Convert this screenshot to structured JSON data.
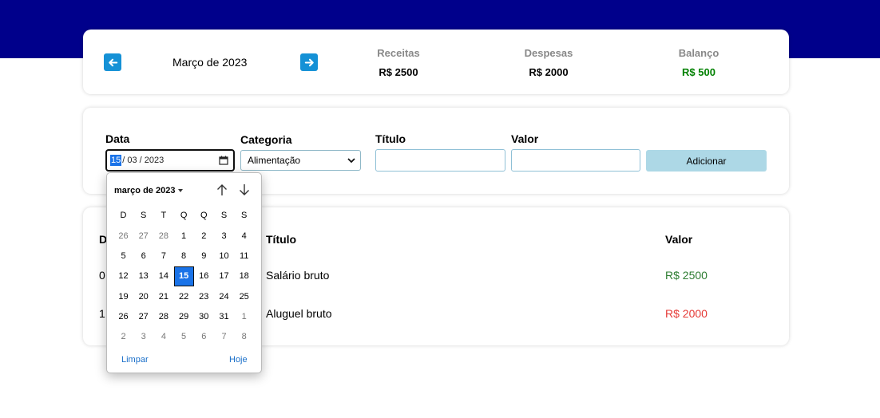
{
  "summary": {
    "month_title": "Março de 2023",
    "receitas": {
      "label": "Receitas",
      "value": "R$ 2500",
      "color": "#000000"
    },
    "despesas": {
      "label": "Despesas",
      "value": "R$ 2000",
      "color": "#000000"
    },
    "balanco": {
      "label": "Balanço",
      "value": "R$ 500",
      "color": "#008000"
    }
  },
  "form": {
    "data_label": "Data",
    "date_day": "15",
    "date_rest": "/ 03 / 2023",
    "categoria_label": "Categoria",
    "categoria_selected": "Alimentação",
    "titulo_label": "Título",
    "valor_label": "Valor",
    "add_label": "Adicionar"
  },
  "table": {
    "headers": {
      "data": "D",
      "titulo": "Título",
      "valor": "Valor"
    },
    "rows": [
      {
        "data": "0",
        "titulo": "Salário bruto",
        "valor": "R$ 2500",
        "valor_color": "#2e7d32"
      },
      {
        "data": "1",
        "titulo": "Aluguel bruto",
        "valor": "R$ 2000",
        "valor_color": "#e53935"
      }
    ]
  },
  "datepicker": {
    "month_label": "março de 2023",
    "weekdays": [
      "D",
      "S",
      "T",
      "Q",
      "Q",
      "S",
      "S"
    ],
    "weeks": [
      [
        {
          "d": "26",
          "o": true
        },
        {
          "d": "27",
          "o": true
        },
        {
          "d": "28",
          "o": true
        },
        {
          "d": "1"
        },
        {
          "d": "2"
        },
        {
          "d": "3"
        },
        {
          "d": "4"
        }
      ],
      [
        {
          "d": "5"
        },
        {
          "d": "6"
        },
        {
          "d": "7"
        },
        {
          "d": "8"
        },
        {
          "d": "9"
        },
        {
          "d": "10"
        },
        {
          "d": "11"
        }
      ],
      [
        {
          "d": "12"
        },
        {
          "d": "13"
        },
        {
          "d": "14"
        },
        {
          "d": "15",
          "s": true
        },
        {
          "d": "16"
        },
        {
          "d": "17"
        },
        {
          "d": "18"
        }
      ],
      [
        {
          "d": "19"
        },
        {
          "d": "20"
        },
        {
          "d": "21"
        },
        {
          "d": "22"
        },
        {
          "d": "23"
        },
        {
          "d": "24"
        },
        {
          "d": "25"
        }
      ],
      [
        {
          "d": "26"
        },
        {
          "d": "27"
        },
        {
          "d": "28"
        },
        {
          "d": "29"
        },
        {
          "d": "30"
        },
        {
          "d": "31"
        },
        {
          "d": "1",
          "o": true
        }
      ],
      [
        {
          "d": "2",
          "o": true
        },
        {
          "d": "3",
          "o": true
        },
        {
          "d": "4",
          "o": true
        },
        {
          "d": "5",
          "o": true
        },
        {
          "d": "6",
          "o": true
        },
        {
          "d": "7",
          "o": true
        },
        {
          "d": "8",
          "o": true
        }
      ]
    ],
    "clear_label": "Limpar",
    "today_label": "Hoje"
  },
  "icons": {
    "prev": "arrow-left-icon",
    "next": "arrow-right-icon",
    "calendar": "calendar-icon",
    "accent": "#1591d6",
    "header_bg": "#00008b"
  }
}
